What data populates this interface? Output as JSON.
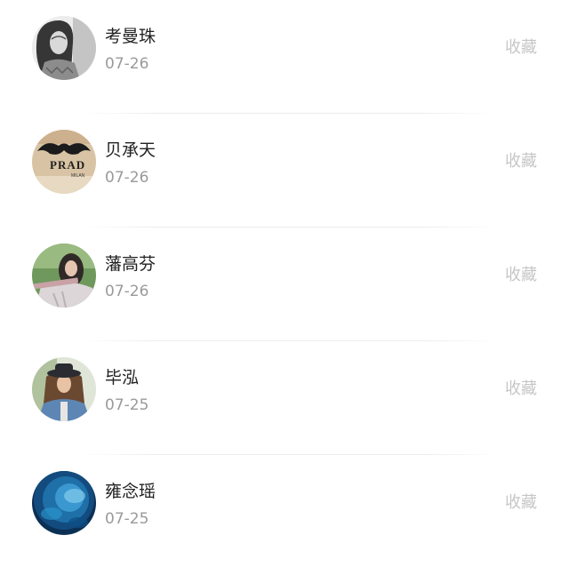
{
  "colors": {
    "background": "#ffffff",
    "name_text": "#222222",
    "date_text": "#9a9a9a",
    "action_text": "#c6c6c6",
    "separator": "#ececec"
  },
  "list": {
    "items": [
      {
        "name": "考曼珠",
        "date": "07-26",
        "action": "收藏",
        "avatar": "grayscale-portrait-photo"
      },
      {
        "name": "贝承天",
        "date": "07-26",
        "action": "收藏",
        "avatar": "mustache-logo-photo",
        "logo_text": "PRAD",
        "logo_subtext": "MILAN"
      },
      {
        "name": "藩高芬",
        "date": "07-26",
        "action": "收藏",
        "avatar": "woman-outdoor-photo"
      },
      {
        "name": "毕泓",
        "date": "07-25",
        "action": "收藏",
        "avatar": "woman-hat-photo"
      },
      {
        "name": "雍念瑶",
        "date": "07-25",
        "action": "收藏",
        "avatar": "blue-underwater-photo"
      }
    ]
  }
}
